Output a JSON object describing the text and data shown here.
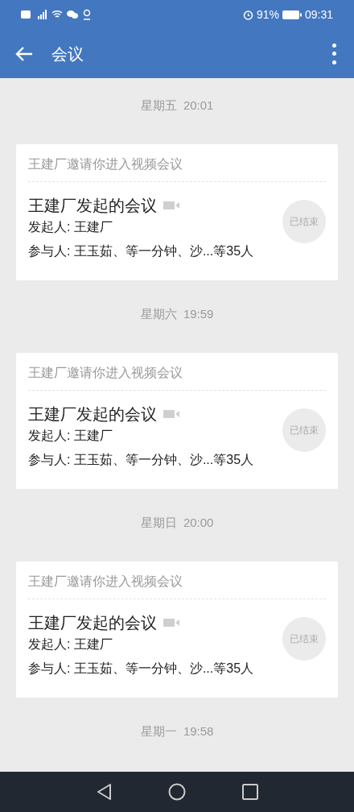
{
  "status_bar": {
    "battery": "91%",
    "time": "09:31"
  },
  "toolbar": {
    "title": "会议"
  },
  "meetings": [
    {
      "date": "星期五  20:01",
      "invite": "王建厂邀请你进入视频会议",
      "title": "王建厂发起的会议",
      "initiator": "发起人: 王建厂",
      "participants": "参与人: 王玉茹、等一分钟、沙...等35人",
      "status": "已结束"
    },
    {
      "date": "星期六  19:59",
      "invite": "王建厂邀请你进入视频会议",
      "title": "王建厂发起的会议",
      "initiator": "发起人: 王建厂",
      "participants": "参与人: 王玉茹、等一分钟、沙...等35人",
      "status": "已结束"
    },
    {
      "date": "星期日  20:00",
      "invite": "王建厂邀请你进入视频会议",
      "title": "王建厂发起的会议",
      "initiator": "发起人: 王建厂",
      "participants": "参与人: 王玉茹、等一分钟、沙...等35人",
      "status": "已结束"
    }
  ],
  "last_date": "星期一  19:58"
}
